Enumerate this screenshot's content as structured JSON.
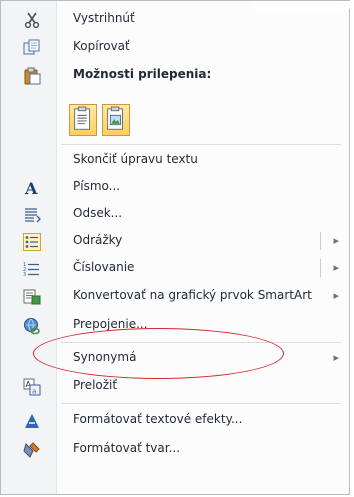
{
  "menu": {
    "items": [
      {
        "id": "cut",
        "label": "Vystrihnúť",
        "icon": "scissors-icon"
      },
      {
        "id": "copy",
        "label": "Kopírovať",
        "icon": "copy-icon"
      },
      {
        "id": "paste_header",
        "label": "Možnosti prilepenia:",
        "icon": "clipboard-icon"
      },
      {
        "id": "exit_text",
        "label": "Skončiť úpravu textu"
      },
      {
        "id": "font",
        "label": "Písmo...",
        "icon": "font-icon"
      },
      {
        "id": "paragraph",
        "label": "Odsek...",
        "icon": "paragraph-icon"
      },
      {
        "id": "bullets",
        "label": "Odrážky",
        "icon": "bullets-icon"
      },
      {
        "id": "numbering",
        "label": "Číslovanie",
        "icon": "numbering-icon"
      },
      {
        "id": "smartart",
        "label": "Konvertovať na grafický prvok SmartArt",
        "icon": "smartart-icon"
      },
      {
        "id": "hyperlink",
        "label": "Prepojenie...",
        "icon": "hyperlink-icon"
      },
      {
        "id": "synonyms",
        "label": "Synonymá"
      },
      {
        "id": "translate",
        "label": "Preložiť",
        "icon": "translate-icon"
      },
      {
        "id": "text_effects",
        "label": "Formátovať textové efekty...",
        "icon": "text-effects-icon"
      },
      {
        "id": "format_shape",
        "label": "Formátovať tvar...",
        "icon": "format-shape-icon"
      }
    ],
    "paste_options": [
      "keep-text-only-icon",
      "picture-paste-icon"
    ]
  },
  "colors": {
    "annotation": "#d4262a",
    "highlight": "#ffcf5a"
  }
}
